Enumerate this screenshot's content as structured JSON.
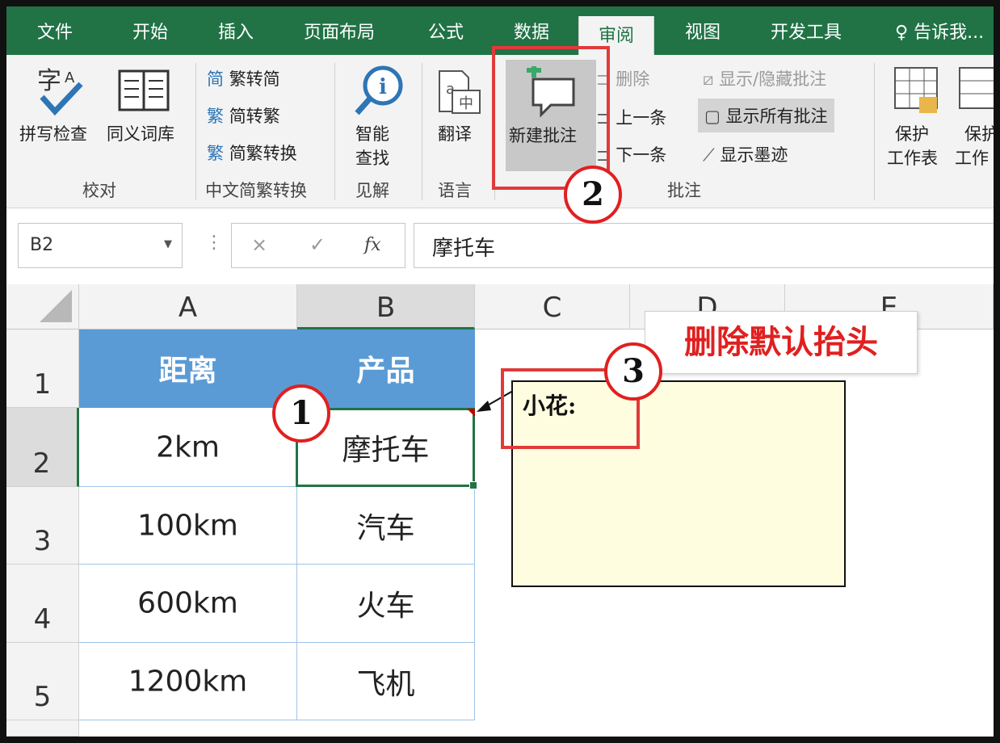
{
  "ribbon": {
    "tabs": [
      "文件",
      "开始",
      "插入",
      "页面布局",
      "公式",
      "数据",
      "审阅",
      "视图",
      "开发工具"
    ],
    "active_tab": "审阅",
    "tell_me": "告诉我...",
    "proofing": {
      "spell_check": "拼写检查",
      "thesaurus": "同义词库",
      "group": "校对"
    },
    "chinese_conversion": {
      "trad_to_simp": "繁转简",
      "simp_to_trad": "简转繁",
      "convert": "简繁转换",
      "group": "中文简繁转换"
    },
    "insights": {
      "smart_lookup_1": "智能",
      "smart_lookup_2": "查找",
      "group": "见解"
    },
    "language": {
      "translate": "翻译",
      "group": "语言"
    },
    "comments": {
      "new_comment": "新建批注",
      "delete": "删除",
      "previous": "上一条",
      "next": "下一条",
      "show_hide": "显示/隐藏批注",
      "show_all": "显示所有批注",
      "show_ink": "显示墨迹",
      "group": "批注"
    },
    "protect": {
      "protect_sheet_1": "保护",
      "protect_sheet_2": "工作表",
      "protect_wb_1": "保护",
      "protect_wb_2": "工作"
    }
  },
  "formula_bar": {
    "name_box": "B2",
    "cancel": "×",
    "enter": "✓",
    "fx": "fx",
    "content": "摩托车"
  },
  "grid": {
    "columns": [
      "A",
      "B",
      "C",
      "D",
      "E"
    ],
    "rows": [
      "1",
      "2",
      "3",
      "4",
      "5"
    ],
    "header": [
      "距离",
      "产品"
    ],
    "data": [
      [
        "2km",
        "摩托车"
      ],
      [
        "100km",
        "汽车"
      ],
      [
        "600km",
        "火车"
      ],
      [
        "1200km",
        "飞机"
      ]
    ],
    "selected_cell": "B2"
  },
  "comment": {
    "author_text": "小花:"
  },
  "annotations": {
    "step1": "1",
    "step2": "2",
    "step3": "3",
    "callout": "删除默认抬头"
  },
  "colors": {
    "excel_green": "#217346",
    "header_blue": "#5b9bd5",
    "annotation_red": "#e02020",
    "comment_bg": "#fffde0"
  }
}
